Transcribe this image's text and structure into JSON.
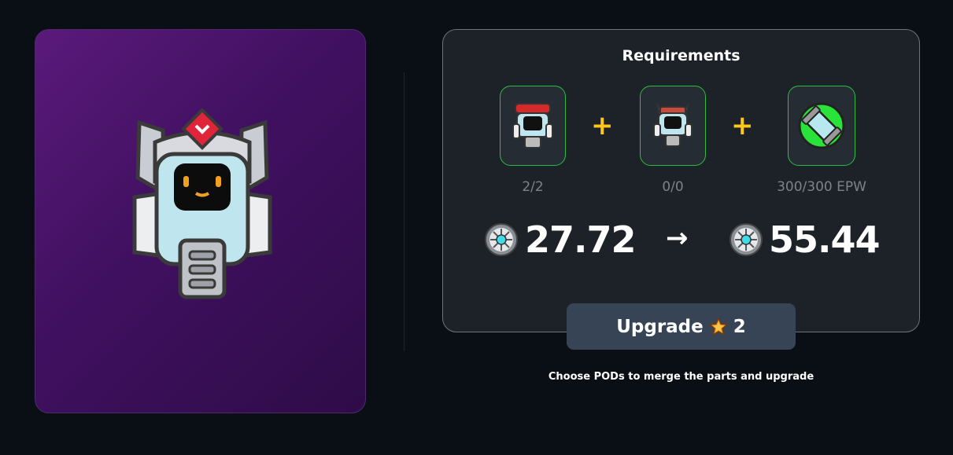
{
  "hero": {
    "image_icon": "robot-pod-icon"
  },
  "requirements": {
    "title": "Requirements",
    "slots": [
      {
        "icon": "robot-pod-red-cap-icon",
        "count": "2/2"
      },
      {
        "icon": "robot-pod-horned-icon",
        "count": "0/0"
      },
      {
        "icon": "energy-capsule-icon",
        "count": "300/300 EPW"
      }
    ],
    "plus": "+",
    "current_value": "27.72",
    "next_value": "55.44",
    "arrow": "→",
    "value_icon": "fan-icon"
  },
  "upgrade": {
    "label": "Upgrade",
    "level": "2",
    "icon": "star-icon"
  },
  "hint": "Choose PODs to merge the parts and upgrade",
  "colors": {
    "accent_green": "#2bbf3c",
    "accent_yellow": "#ffc718",
    "button_bg": "#374455"
  }
}
